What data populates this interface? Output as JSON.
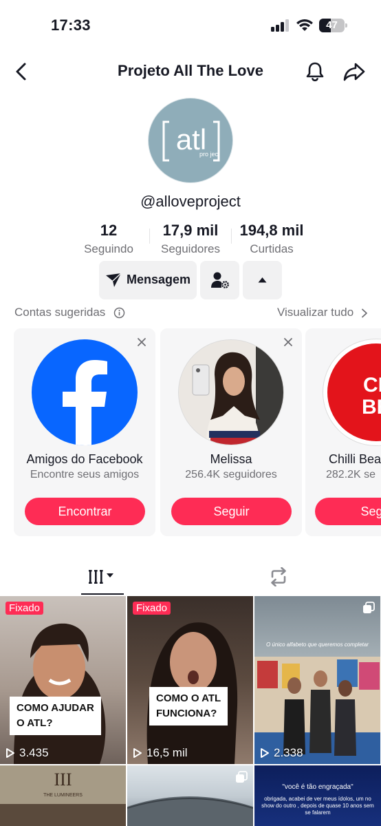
{
  "status_bar": {
    "time": "17:33",
    "battery": "47",
    "battery_level": 0.47
  },
  "header": {
    "title": "Projeto All The Love",
    "back_icon": "chevron-left-icon",
    "bell_icon": "bell-icon",
    "share_icon": "share-arrow-icon"
  },
  "profile": {
    "avatar_text": "atl",
    "avatar_sub": "pro ject",
    "avatar_color": "#8fadb9",
    "username": "@alloveproject",
    "stats": [
      {
        "value": "12",
        "label": "Seguindo"
      },
      {
        "value": "17,9 mil",
        "label": "Seguidores"
      },
      {
        "value": "194,8 mil",
        "label": "Curtidas"
      }
    ]
  },
  "actions": {
    "message_label": "Mensagem"
  },
  "suggested": {
    "title": "Contas sugeridas",
    "view_all": "Visualizar tudo",
    "cards": [
      {
        "name": "Amigos do Facebook",
        "subtitle": "Encontre seus amigos",
        "button": "Encontrar"
      },
      {
        "name": "Melissa",
        "subtitle": "256.4K seguidores",
        "button": "Seguir"
      },
      {
        "name": "Chilli Bea",
        "subtitle": "282.2K se",
        "button": "Segu",
        "logo_text_1": "CHI",
        "logo_text_2": "BEA"
      }
    ]
  },
  "videos": [
    {
      "pinned": "Fixado",
      "caption_1": "COMO AJUDAR",
      "caption_2": "O ATL?",
      "views": "3.435"
    },
    {
      "pinned": "Fixado",
      "caption_1": "COMO O ATL",
      "caption_2": "FUNCIONA?",
      "views": "16,5 mil"
    },
    {
      "overlay": "O único alfabeto que queremos completar",
      "views": "2.338"
    },
    {
      "title": "III",
      "sub": "THE LUMINEERS"
    },
    {},
    {
      "quote": "\"você é tão engraçada\"",
      "body": "obrigada, acabei de ver meus ídolos, um no show do outro , depois de quase 10 anos sem se falarem"
    }
  ],
  "colors": {
    "accent": "#fe2c55",
    "text": "#161823",
    "muted": "#6e6e73",
    "card_bg": "#f6f6f7",
    "button_bg": "#f1f1f2",
    "facebook": "#0866ff"
  }
}
